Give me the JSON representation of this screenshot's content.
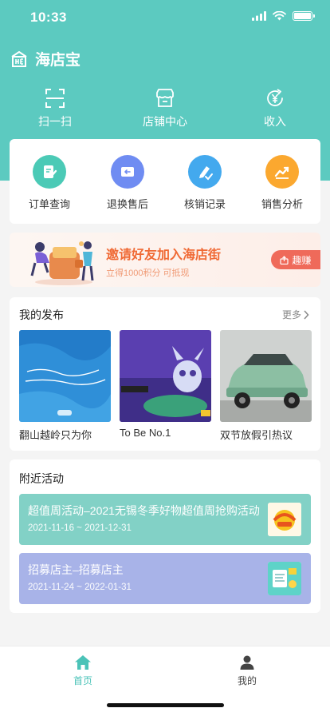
{
  "status": {
    "time": "10:33"
  },
  "app": {
    "title": "海店宝"
  },
  "top_actions": [
    {
      "label": "扫一扫",
      "icon": "scan-icon"
    },
    {
      "label": "店铺中心",
      "icon": "store-icon"
    },
    {
      "label": "收入",
      "icon": "income-icon"
    }
  ],
  "quick": [
    {
      "label": "订单查询",
      "icon": "order-icon",
      "color": "#4bcab6"
    },
    {
      "label": "退换售后",
      "icon": "return-icon",
      "color": "#6f8cf2"
    },
    {
      "label": "核销记录",
      "icon": "verify-icon",
      "color": "#43a9ee"
    },
    {
      "label": "销售分析",
      "icon": "chart-icon",
      "color": "#fba82f"
    }
  ],
  "banner": {
    "title": "邀请好友加入海店街",
    "subtitle": "立得1000积分 可抵现",
    "button": "趣赚"
  },
  "posts": {
    "title": "我的发布",
    "more": "更多",
    "items": [
      {
        "caption": "翻山越岭只为你"
      },
      {
        "caption": "To Be No.1"
      },
      {
        "caption": "双节放假引热议"
      }
    ]
  },
  "activity": {
    "title": "附近活动",
    "items": [
      {
        "title": "超值周活动–2021无锡冬季好物超值周抢购活动",
        "date": "2021-11-16 ~ 2021-12-31",
        "color": "#82d1c6"
      },
      {
        "title": "招募店主–招募店主",
        "date": "2021-11-24 ~ 2022-01-31",
        "color": "#a8b3e8"
      }
    ]
  },
  "tabs": [
    {
      "label": "首页",
      "icon": "home-icon",
      "active": true,
      "color": "#4bc3b8"
    },
    {
      "label": "我的",
      "icon": "user-icon",
      "active": false,
      "color": "#444"
    }
  ]
}
